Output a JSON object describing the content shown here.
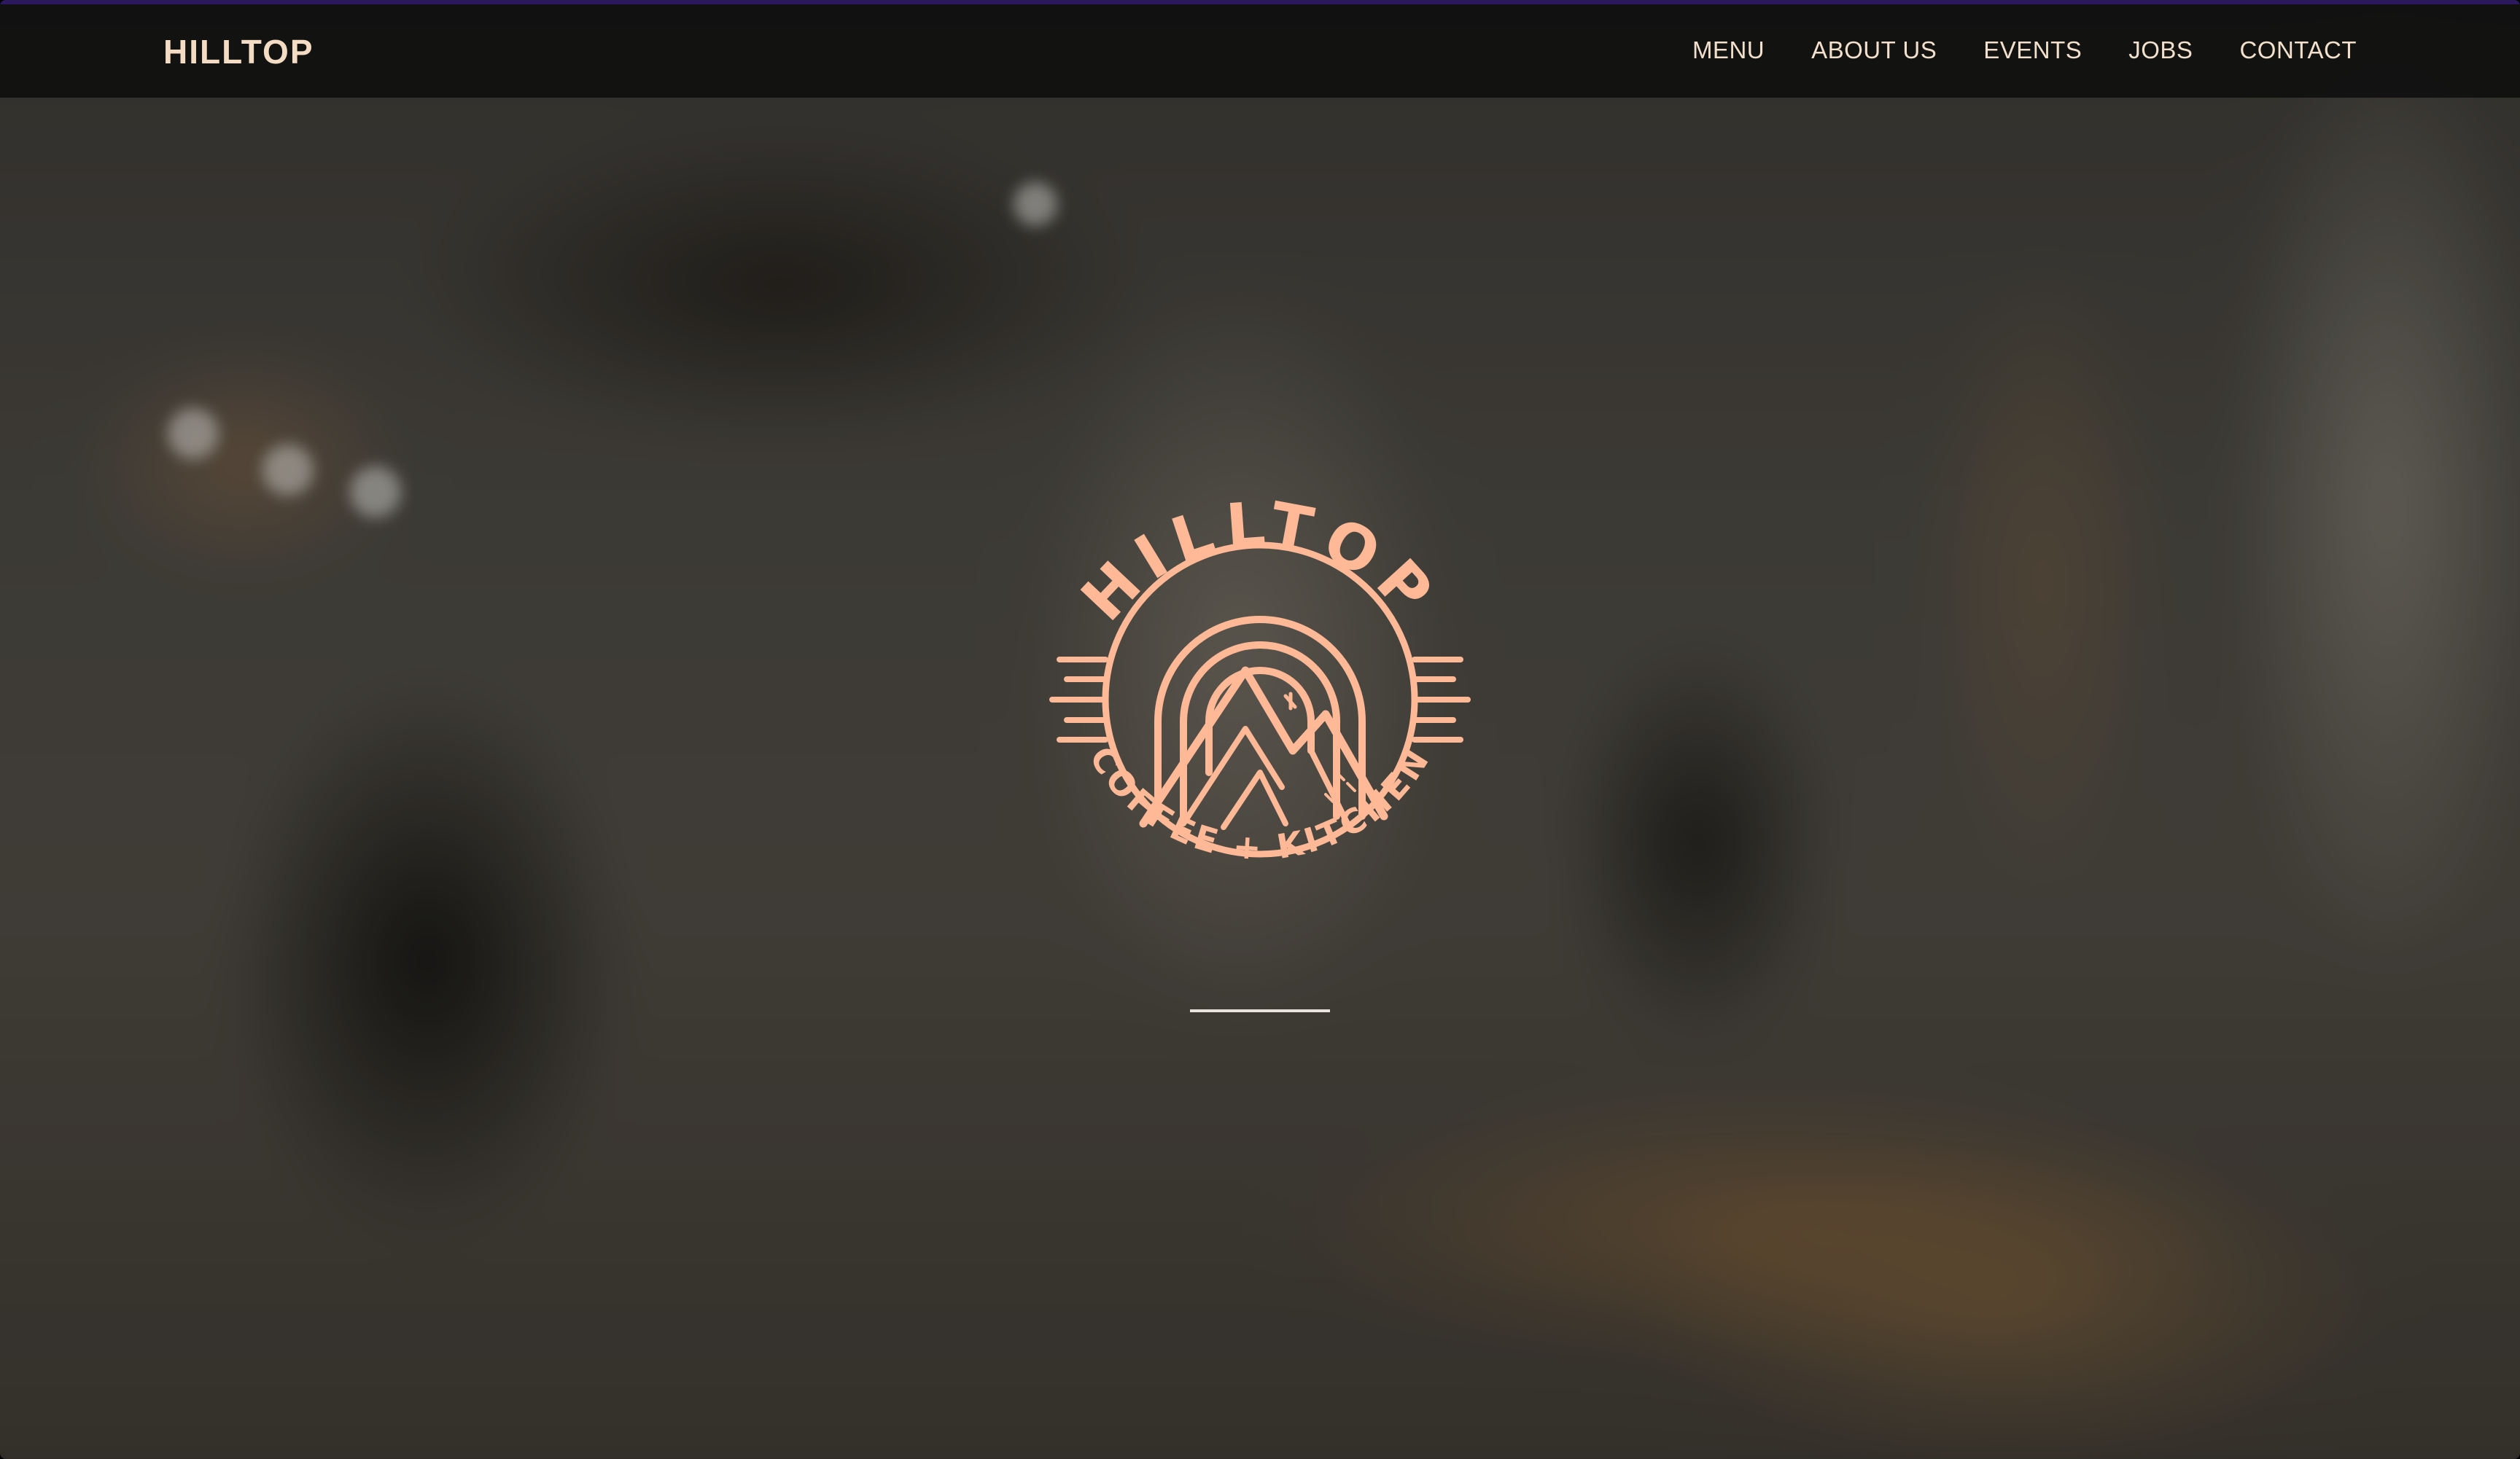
{
  "nav": {
    "brand": "HILLTOP",
    "links": [
      {
        "label": "MENU"
      },
      {
        "label": "ABOUT US"
      },
      {
        "label": "EVENTS"
      },
      {
        "label": "JOBS"
      },
      {
        "label": "CONTACT"
      }
    ]
  },
  "hero": {
    "logo_top_text": "HILLTOP",
    "logo_bottom_text": "COFFEE + KITCHEN"
  },
  "colors": {
    "logo": "#ffb997",
    "nav_text": "#f2e0cc",
    "nav_bg": "#101010",
    "accent_line": "#2b1960"
  }
}
